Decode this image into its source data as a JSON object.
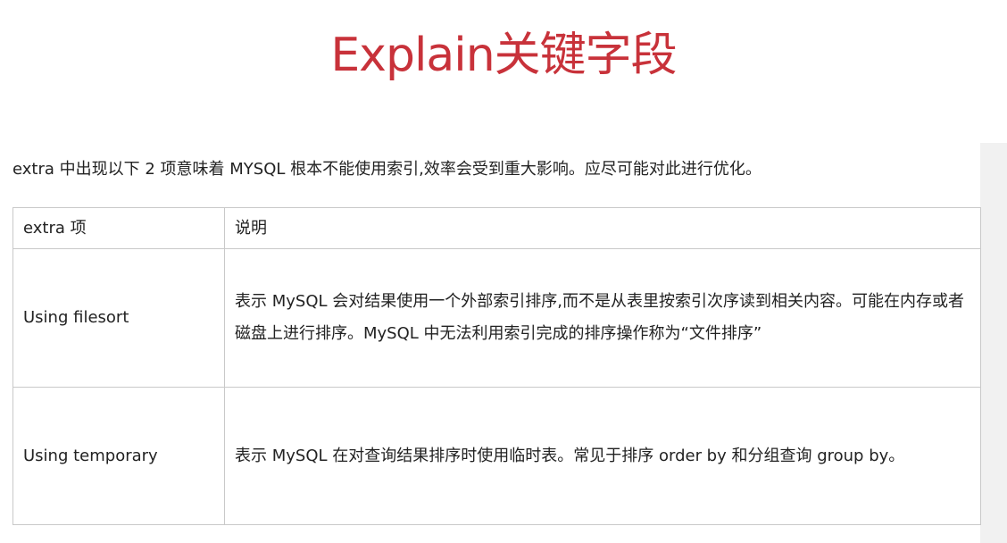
{
  "title": "Explain关键字段",
  "intro": "extra 中出现以下 2 项意味着 MYSQL 根本不能使用索引,效率会受到重大影响。应尽可能对此进行优化。",
  "table": {
    "headers": [
      "extra 项",
      "说明"
    ],
    "rows": [
      {
        "item": "Using filesort",
        "description": "表示 MySQL 会对结果使用一个外部索引排序,而不是从表里按索引次序读到相关内容。可能在内存或者磁盘上进行排序。MySQL 中无法利用索引完成的排序操作称为“文件排序”"
      },
      {
        "item": "Using temporary",
        "description": "表示 MySQL 在对查询结果排序时使用临时表。常见于排序 order by 和分组查询 group by。"
      }
    ]
  },
  "colors": {
    "title": "#c8323a",
    "border": "#c9c9c9",
    "text": "#222222"
  }
}
